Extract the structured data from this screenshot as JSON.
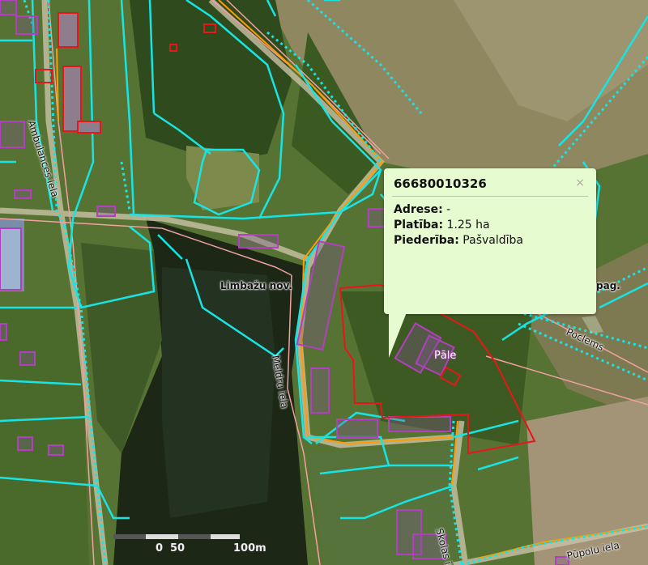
{
  "map": {
    "municipality_label": "Limbažu nov.",
    "edge_label": "pag.",
    "place_label": "Pāle",
    "streets": [
      "Ambulances iela",
      "Meldru iela",
      "Skolas iela",
      "Pūpolu iela",
      "Poclems"
    ]
  },
  "popup": {
    "title": "66680010326",
    "close": "×",
    "rows": [
      {
        "label": "Adrese:",
        "value": "-"
      },
      {
        "label": "Platība:",
        "value": "1.25 ha"
      },
      {
        "label": "Piederība:",
        "value": "Pašvaldība"
      }
    ]
  },
  "scale": {
    "labels": [
      "0",
      "50",
      "100m"
    ]
  },
  "colors": {
    "parcel": "#19e4e4",
    "selected": "#e8161a",
    "building": "#b23fbf",
    "road_center": "#ff9c00",
    "road_edge": "#f2a0a0"
  }
}
